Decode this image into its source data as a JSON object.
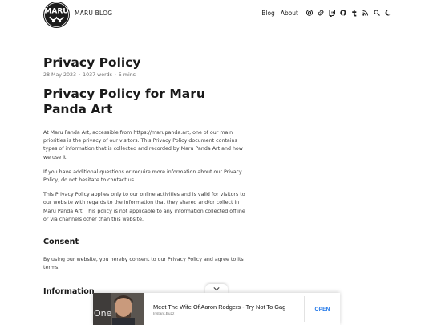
{
  "header": {
    "logo_alt": "MARU",
    "site_title": "MARU BLOG",
    "nav": [
      {
        "label": "Blog"
      },
      {
        "label": "About"
      }
    ],
    "icons": [
      "at-icon",
      "link-icon",
      "twitch-icon",
      "github-icon",
      "tumblr-icon",
      "rss-icon",
      "search-icon",
      "dark-mode-moon-icon"
    ]
  },
  "post": {
    "title": "Privacy Policy",
    "date": "28 May 2023",
    "words": "1037 words",
    "read_time": "5 mins",
    "h1": "Privacy Policy for Maru Panda Art",
    "paragraphs": [
      "At Maru Panda Art, accessible from https://marupanda.art, one of our main priorities is the privacy of our visitors. This Privacy Policy document contains types of information that is collected and recorded by Maru Panda Art and how we use it.",
      "If you have additional questions or require more information about our Privacy Policy, do not hesitate to contact us.",
      "This Privacy Policy applies only to our online activities and is valid for visitors to our website with regards to the information that they shared and/or collect in Maru Panda Art. This policy is not applicable to any information collected offline or via channels other than this website."
    ],
    "consent_heading": "Consent",
    "consent_text": "By using our website, you hereby consent to our Privacy Policy and agree to its terms.",
    "next_heading": "Information"
  },
  "ad": {
    "headline": "Meet The Wife Of Aaron Rodgers - Try Not To Gag",
    "source": "Instant.Buzz",
    "cta": "OPEN",
    "image_text": "One"
  }
}
